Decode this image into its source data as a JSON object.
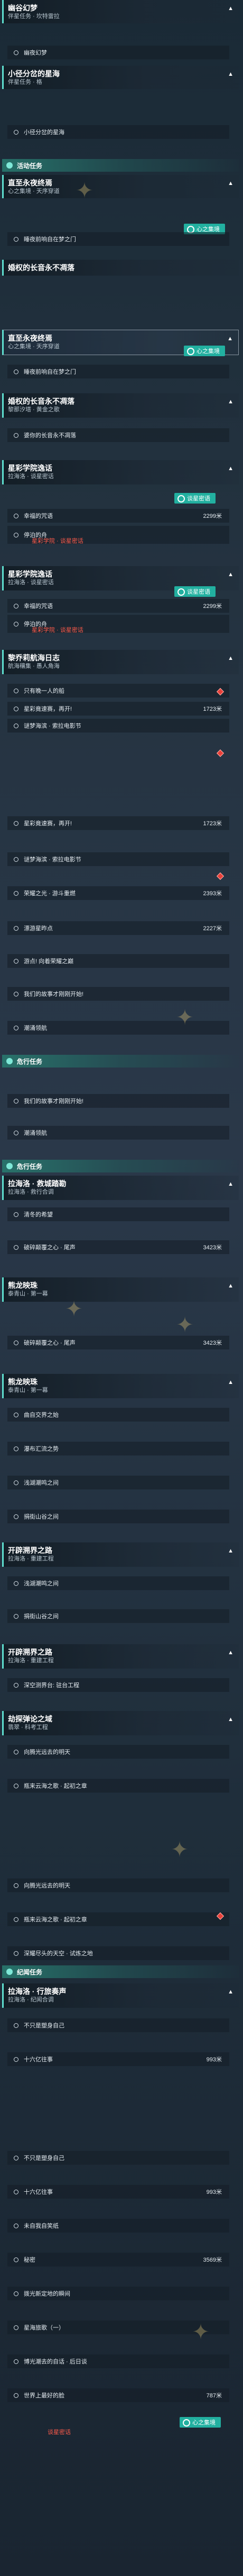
{
  "quests": [
    {
      "title": "幽谷幻梦",
      "sub": "伴星任务 · 坎特雷拉"
    },
    {
      "title": "小径分岔的星海",
      "sub": "伴星任务 · 格"
    },
    {
      "title": "直至永夜终焉",
      "sub": "心之集境 · 天序穿道"
    },
    {
      "title": "婚权的长音永不凋落",
      "sub": ""
    },
    {
      "title": "直至永夜终焉",
      "sub": "心之集境 · 天序穿道"
    },
    {
      "title": "婚权的长音永不凋落",
      "sub": "黎那汐塔 · 黄金之歌"
    },
    {
      "title": "星彩学院逸话",
      "sub": "拉海洛 · 谈星密话"
    },
    {
      "title": "星彩学院逸话",
      "sub": "拉海洛 · 谈星密话"
    },
    {
      "title": "黎乔莉航海日志",
      "sub": "航海穰集 · 愚人角海"
    },
    {
      "title": "拉海洛 · 救城踏勘",
      "sub": "拉海洛 · 救行合调"
    },
    {
      "title": "熊龙映珠",
      "sub": "泰青山 · 第一幕"
    },
    {
      "title": "熊龙映珠",
      "sub": "泰青山 · 第一幕"
    },
    {
      "title": "开辟溯界之路",
      "sub": "拉海洛 · 重建工程"
    },
    {
      "title": "开辟溯界之路",
      "sub": "拉海洛 · 重建工程"
    },
    {
      "title": "劫探弹论之域",
      "sub": "翡翠 · 科考工程"
    },
    {
      "title": "拉海洛 · 行旅奏声",
      "sub": "拉海洛 · 纪闻合调"
    }
  ],
  "rows": [
    {
      "label": "幽夜幻梦",
      "value": ""
    },
    {
      "label": "小径分岔的星海",
      "value": ""
    },
    {
      "label": "睡夜前响自在梦之门",
      "value": ""
    },
    {
      "label": "睡夜前响自在梦之门",
      "value": ""
    },
    {
      "label": "婆你的长音永不凋落",
      "value": ""
    },
    {
      "label": "幸福的咒语",
      "value": "2299米"
    },
    {
      "label": "停泊的舟",
      "value": ""
    },
    {
      "label": "幸福的咒语",
      "value": "2299米"
    },
    {
      "label": "停泊的舟",
      "value": ""
    },
    {
      "label": "只有晚一人的船",
      "value": ""
    },
    {
      "label": "星彩竟速赛，再开!",
      "value": "1723米"
    },
    {
      "label": "谜梦海滨 · 索拉电影节",
      "value": ""
    },
    {
      "label": "星彩竟速赛，再开!",
      "value": "1723米"
    },
    {
      "label": "谜梦海滨 · 索拉电影节",
      "value": ""
    },
    {
      "label": "荣耀之光 · 游斗重燃",
      "value": "2393米"
    },
    {
      "label": "漂游星昨点",
      "value": "2227米"
    },
    {
      "label": "游点! 向着荣耀之巅",
      "value": ""
    },
    {
      "label": "我们的故事才刚刚开始!",
      "value": ""
    },
    {
      "label": "潮涌领航",
      "value": ""
    },
    {
      "label": "我们的故事才刚刚开始!",
      "value": ""
    },
    {
      "label": "潮涌领航",
      "value": ""
    },
    {
      "label": "清冬的希望",
      "value": ""
    },
    {
      "label": "破碎颠覆之心 · 尾声",
      "value": "3423米"
    },
    {
      "label": "破碎颠覆之心 · 尾声",
      "value": "3423米"
    },
    {
      "label": "曲自交界之始",
      "value": ""
    },
    {
      "label": "瀑布汇流之势",
      "value": ""
    },
    {
      "label": "浅湖潮鸣之间",
      "value": ""
    },
    {
      "label": "捐街山谷之间",
      "value": ""
    },
    {
      "label": "浅湖潮鸣之间",
      "value": ""
    },
    {
      "label": "捐街山谷之间",
      "value": ""
    },
    {
      "label": "深空测界台: 驻台工程",
      "value": ""
    },
    {
      "label": "向腾光远去的明天",
      "value": ""
    },
    {
      "label": "瓶来云海之歌 · 起初之章",
      "value": ""
    },
    {
      "label": "向腾光远去的明天",
      "value": ""
    },
    {
      "label": "瓶来云海之歌 · 起初之章",
      "value": ""
    },
    {
      "label": "深耀尽头的天空 · 试炼之地",
      "value": ""
    },
    {
      "label": "不只是塑身自己",
      "value": ""
    },
    {
      "label": "十六亿往事",
      "value": "993米"
    },
    {
      "label": "不只是塑身自己",
      "value": ""
    },
    {
      "label": "十六亿往事",
      "value": "993米"
    },
    {
      "label": "未自我自笑纸",
      "value": ""
    },
    {
      "label": "秘密",
      "value": "3569米"
    },
    {
      "label": "拨光新定地的瞬间",
      "value": ""
    },
    {
      "label": "星海旅歌（一）",
      "value": ""
    },
    {
      "label": "博光潮去的自话 · 后日谈",
      "value": ""
    },
    {
      "label": "世界上最好的脸",
      "value": "787米"
    }
  ],
  "categories": [
    {
      "label": "活动任务"
    },
    {
      "label": "危行任务"
    },
    {
      "label": "危行任务"
    },
    {
      "label": "纪闻任务"
    }
  ],
  "badges": [
    {
      "label": "心之集境"
    },
    {
      "label": "心之集境"
    },
    {
      "label": "谈星密语"
    },
    {
      "label": "谈星密语"
    },
    {
      "label": "心之集境"
    }
  ],
  "warnings": [
    {
      "text": "星彩学院 · 谈星密话"
    },
    {
      "text": "星彩学院 · 谈星密话"
    },
    {
      "text": "星彩学院 · 谈星密话"
    },
    {
      "text": "谈星密话"
    }
  ],
  "colors": {
    "accent": "#5fe0d0",
    "badge": "#22b0a0",
    "warning": "#ff5a4a",
    "marker": "#e8403a"
  }
}
